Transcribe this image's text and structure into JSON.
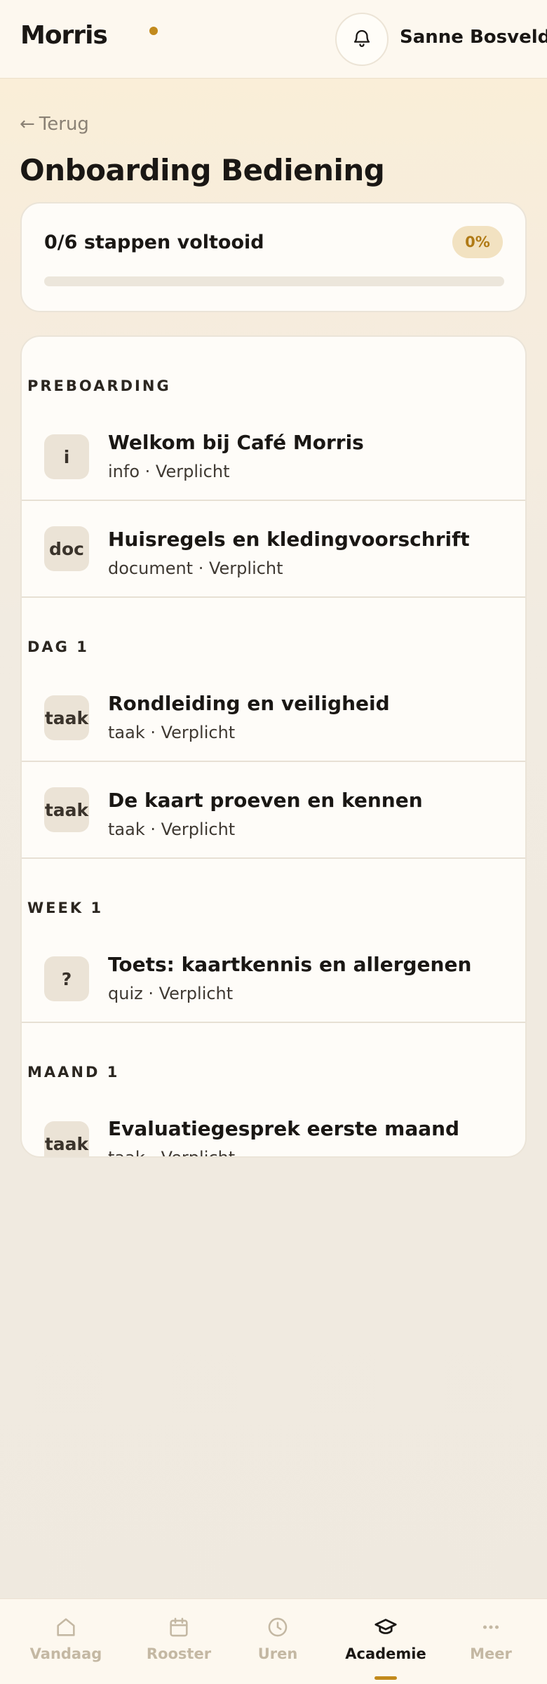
{
  "header": {
    "logo_text": "Morris",
    "user_name": "Sanne Bosveld",
    "brand_accent": "#c28a1c",
    "bell_icon": "bell-icon"
  },
  "page": {
    "back_label": "Terug",
    "back_arrow": "←",
    "title": "Onboarding Bediening"
  },
  "progress": {
    "summary": "0/6 stappen voltooid",
    "percent_label": "0%",
    "percent_value": 0
  },
  "sections": [
    {
      "title": "PREBOARDING",
      "steps": [
        {
          "icon": "i",
          "title": "Welkom bij Café Morris",
          "meta": "info · Verplicht"
        },
        {
          "icon": "doc",
          "title": "Huisregels en kledingvoorschrift",
          "meta": "document · Verplicht"
        }
      ]
    },
    {
      "title": "DAG 1",
      "steps": [
        {
          "icon": "taak",
          "title": "Rondleiding en veiligheid",
          "meta": "taak · Verplicht"
        },
        {
          "icon": "taak",
          "title": "De kaart proeven en kennen",
          "meta": "taak · Verplicht"
        }
      ]
    },
    {
      "title": "WEEK 1",
      "steps": [
        {
          "icon": "?",
          "title": "Toets: kaartkennis en allergenen",
          "meta": "quiz · Verplicht"
        }
      ]
    },
    {
      "title": "MAAND 1",
      "steps": [
        {
          "icon": "taak",
          "title": "Evaluatiegesprek eerste maand",
          "meta": "taak · Verplicht"
        }
      ]
    }
  ],
  "nav": {
    "items": [
      {
        "label": "Vandaag",
        "icon": "home-icon"
      },
      {
        "label": "Rooster",
        "icon": "calendar-icon"
      },
      {
        "label": "Uren",
        "icon": "clock-icon"
      },
      {
        "label": "Academie",
        "icon": "graduation-cap-icon",
        "active": true
      },
      {
        "label": "Meer",
        "icon": "more-icon"
      }
    ]
  }
}
